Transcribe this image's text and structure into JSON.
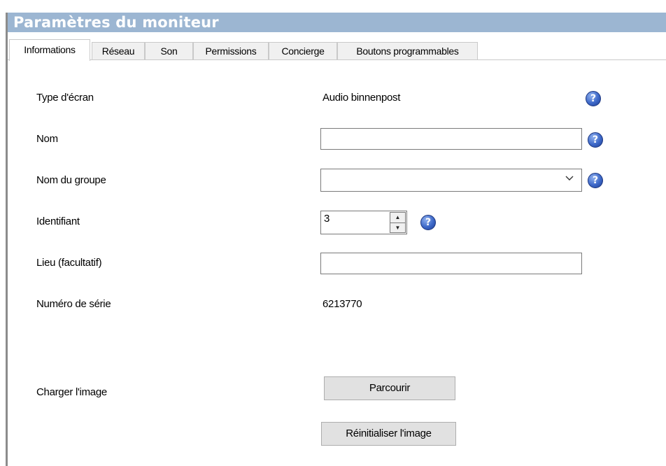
{
  "window": {
    "title": "Paramètres du moniteur"
  },
  "tabs": [
    {
      "label": "Informations",
      "active": true
    },
    {
      "label": "Réseau"
    },
    {
      "label": "Son"
    },
    {
      "label": "Permissions"
    },
    {
      "label": "Concierge"
    },
    {
      "label": "Boutons programmables"
    }
  ],
  "form": {
    "screen_type": {
      "label": "Type d'écran",
      "value": "Audio binnenpost"
    },
    "name": {
      "label": "Nom",
      "value": ""
    },
    "group_name": {
      "label": "Nom du groupe",
      "value": ""
    },
    "identifier": {
      "label": "Identifiant",
      "value": "3"
    },
    "location": {
      "label": "Lieu (facultatif)",
      "value": ""
    },
    "serial": {
      "label": "Numéro de série",
      "value": "6213770"
    },
    "image": {
      "label": "Charger l'image",
      "browse_label": "Parcourir",
      "reset_label": "Réinitialiser l'image"
    }
  },
  "help_icon": "?",
  "icons": [
    "help-icon",
    "chevron-down-icon",
    "spin-up-icon",
    "spin-down-icon"
  ],
  "colors": {
    "title_bar": "#9cb6d2",
    "help_icon": "#3d68c8"
  }
}
